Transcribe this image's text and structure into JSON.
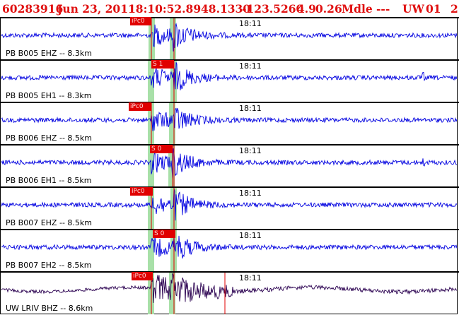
{
  "header": {
    "event_id": "60283916",
    "date": "Jun 23, 2011",
    "time": "18:10:52.89",
    "lat": "48.1330",
    "lon": "-123.5260",
    "depth": "4.9",
    "mag": "0.26",
    "mag_type": "Md",
    "type": "le",
    "dashes": "---",
    "network": "UW",
    "version": "01",
    "extra": "2"
  },
  "colors": {
    "trace": "#0000e0",
    "trace_last": "#2a0050",
    "pick": "#e00000",
    "window": "#a8e0a8",
    "header_text": "#e01010"
  },
  "panels": [
    {
      "label": "PB B005 EHZ -- 8.3km",
      "time": "18:11",
      "pick": "iPc0"
    },
    {
      "label": "PB B005 EH1 -- 8.3km",
      "time": "18:11",
      "pick": "S 1"
    },
    {
      "label": "PB B006 EHZ -- 8.5km",
      "time": "18:11",
      "pick": "iPc0"
    },
    {
      "label": "PB B006 EH1 -- 8.5km",
      "time": "18:11",
      "pick": "S 0"
    },
    {
      "label": "PB B007 EHZ -- 8.5km",
      "time": "18:11",
      "pick": "iPc0"
    },
    {
      "label": "PB B007 EH2 -- 8.5km",
      "time": "18:11",
      "pick": "S 0"
    },
    {
      "label": "UW LRIV BHZ -- 8.6km",
      "time": "18:11",
      "pick": "iPc0"
    }
  ]
}
